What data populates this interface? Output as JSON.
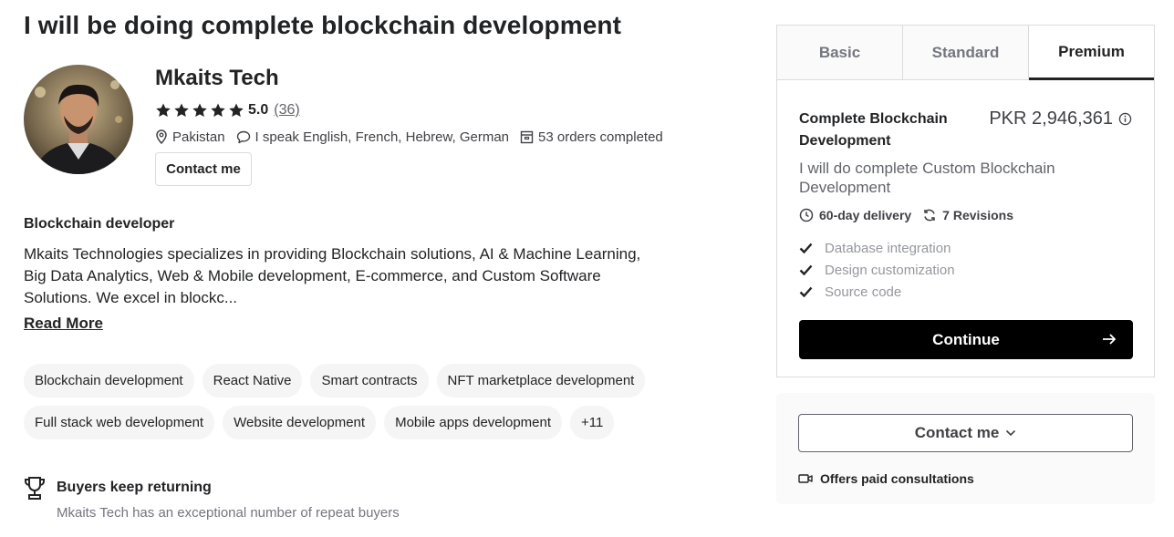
{
  "gig": {
    "title": "I will be doing complete blockchain development"
  },
  "seller": {
    "name": "Mkaits Tech",
    "rating": "5.0",
    "rating_count": "(36)",
    "location": "Pakistan",
    "languages": "I speak English, French, Hebrew, German",
    "orders": "53 orders completed",
    "contact_label": "Contact me"
  },
  "about": {
    "heading": "Blockchain developer",
    "body": "Mkaits Technologies specializes in providing Blockchain solutions, AI & Machine Learning, Big Data Analytics, Web & Mobile development, E-commerce, and Custom Software Solutions. We excel in blockc...",
    "read_more": "Read More"
  },
  "tags": [
    "Blockchain development",
    "React Native",
    "Smart contracts",
    "NFT marketplace development",
    "Full stack web development",
    "Website development",
    "Mobile apps development",
    "+11"
  ],
  "buyers": {
    "title": "Buyers keep returning",
    "subtitle": "Mkaits Tech has an exceptional number of repeat buyers"
  },
  "package": {
    "tabs": [
      "Basic",
      "Standard",
      "Premium"
    ],
    "active_tab": "Premium",
    "name": "Complete Blockchain Development",
    "price": "PKR 2,946,361",
    "description": "I will do complete Custom Blockchain Development",
    "delivery": "60-day delivery",
    "revisions": "7 Revisions",
    "features": [
      "Database integration",
      "Design customization",
      "Source code"
    ],
    "continue_label": "Continue"
  },
  "contact_panel": {
    "button_label": "Contact me",
    "consultation": "Offers paid consultations"
  },
  "colors": {
    "text_primary": "#222325",
    "text_muted": "#74767e",
    "tag_bg": "#f5f5f5",
    "button_dark": "#000000",
    "border": "#dadbdd"
  }
}
